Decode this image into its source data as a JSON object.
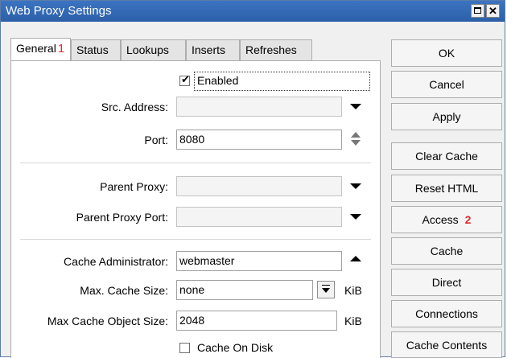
{
  "window": {
    "title": "Web Proxy Settings"
  },
  "tabs": [
    {
      "label": "General",
      "marker": "1"
    },
    {
      "label": "Status"
    },
    {
      "label": "Lookups"
    },
    {
      "label": "Inserts"
    },
    {
      "label": "Refreshes"
    }
  ],
  "form": {
    "enabled": {
      "label": "Enabled",
      "checked": true
    },
    "src_address": {
      "label": "Src. Address:",
      "value": ""
    },
    "port": {
      "label": "Port:",
      "value": "8080"
    },
    "parent_proxy": {
      "label": "Parent Proxy:",
      "value": ""
    },
    "parent_proxy_port": {
      "label": "Parent Proxy Port:",
      "value": ""
    },
    "cache_administrator": {
      "label": "Cache Administrator:",
      "value": "webmaster"
    },
    "max_cache_size": {
      "label": "Max. Cache Size:",
      "value": "none",
      "unit": "KiB"
    },
    "max_cache_object_size": {
      "label": "Max Cache Object Size:",
      "value": "2048",
      "unit": "KiB"
    },
    "cache_on_disk": {
      "label": "Cache On Disk",
      "checked": false
    }
  },
  "buttons": {
    "ok": "OK",
    "cancel": "Cancel",
    "apply": "Apply",
    "clear_cache": "Clear Cache",
    "reset_html": "Reset HTML",
    "access": {
      "label": "Access",
      "marker": "2"
    },
    "cache": "Cache",
    "direct": "Direct",
    "connections": "Connections",
    "cache_contents": "Cache Contents"
  }
}
